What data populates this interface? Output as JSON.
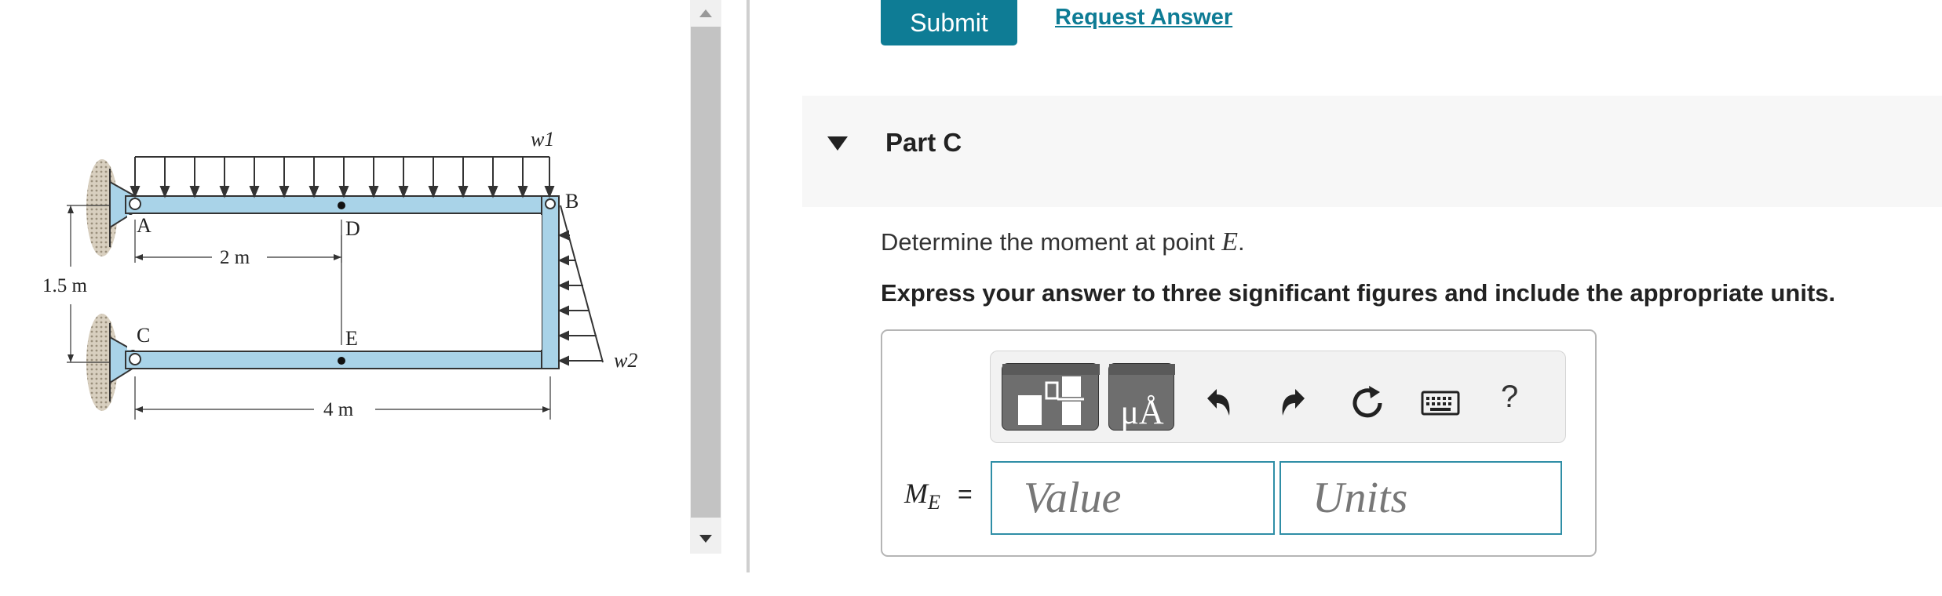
{
  "figure": {
    "point_labels": [
      "A",
      "B",
      "C",
      "D",
      "E"
    ],
    "load_labels": [
      "w1",
      "w2"
    ],
    "dimensions": {
      "span_ad": "2 m",
      "height": "1.5 m",
      "span_ce": "4 m"
    }
  },
  "toolbar": {
    "submit_label": "Submit",
    "request_answer_label": "Request Answer",
    "icons": [
      "template-icon",
      "units-icon",
      "undo-icon",
      "redo-icon",
      "reset-icon",
      "keyboard-icon",
      "help-icon"
    ],
    "units_glyph": "μÅ",
    "help_glyph": "?"
  },
  "part": {
    "title": "Part C",
    "question_prefix": "Determine the moment at point ",
    "question_var": "E",
    "question_suffix": ".",
    "instruction": "Express your answer to three significant figures and include the appropriate units."
  },
  "answer": {
    "label_main": "M",
    "label_sub": "E",
    "equals": "=",
    "value_placeholder": "Value",
    "units_placeholder": "Units"
  },
  "colors": {
    "accent": "#0e7c95",
    "beam_fill": "#a9d3e8",
    "input_border": "#2f8ea6"
  }
}
